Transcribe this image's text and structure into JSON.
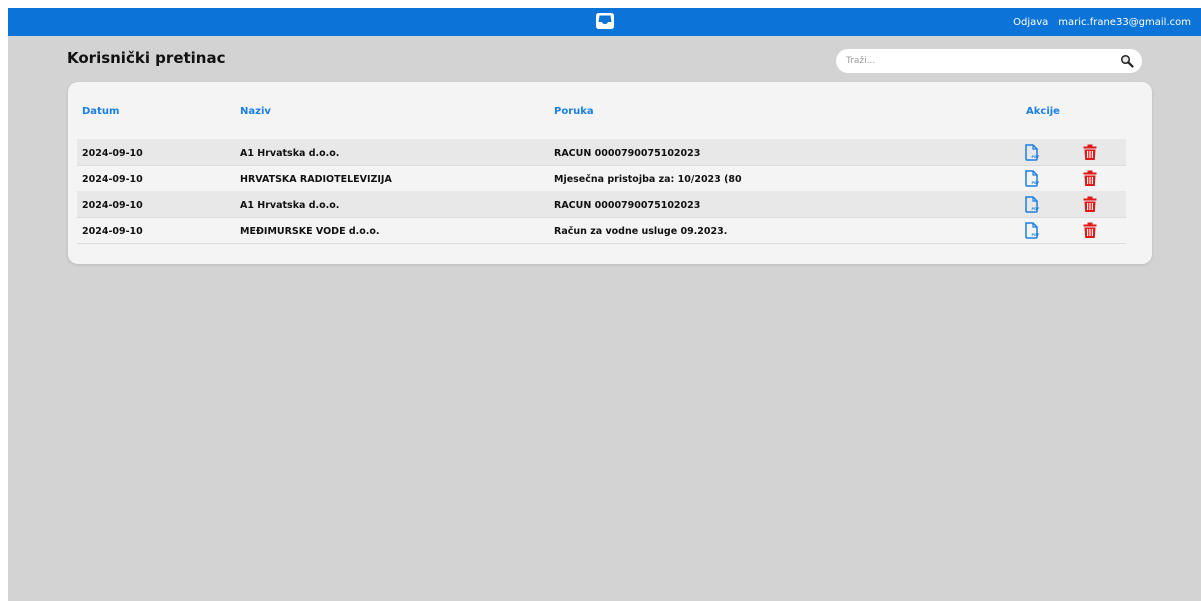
{
  "header": {
    "logout_label": "Odjava",
    "user_email": "maric.frane33@gmail.com",
    "logo_icon": "inbox-tray-icon",
    "bg_color": "#0b74d6"
  },
  "page": {
    "title": "Korisnički pretinac"
  },
  "search": {
    "placeholder": "Traži...",
    "value": "",
    "icon": "magnifier-icon"
  },
  "table": {
    "headers": {
      "date": "Datum",
      "name": "Naziv",
      "message": "Poruka",
      "actions": "Akcije"
    },
    "header_color": "#1a7fe0",
    "rows": [
      {
        "date": "2024-09-10",
        "name": "A1 Hrvatska d.o.o.",
        "message": "RACUN 0000790075102023"
      },
      {
        "date": "2024-09-10",
        "name": "HRVATSKA RADIOTELEVIZIJA",
        "message": "Mjesečna pristojba za: 10/2023 (80"
      },
      {
        "date": "2024-09-10",
        "name": "A1 Hrvatska d.o.o.",
        "message": "RACUN 0000790075102023"
      },
      {
        "date": "2024-09-10",
        "name": "MEĐIMURSKE VODE d.o.o.",
        "message": "Račun za vodne usluge 09.2023."
      }
    ],
    "action_icons": {
      "pdf": "pdf-file-icon",
      "delete": "trash-icon"
    },
    "pdf_color": "#1a7fe0",
    "delete_color": "#e01919"
  }
}
